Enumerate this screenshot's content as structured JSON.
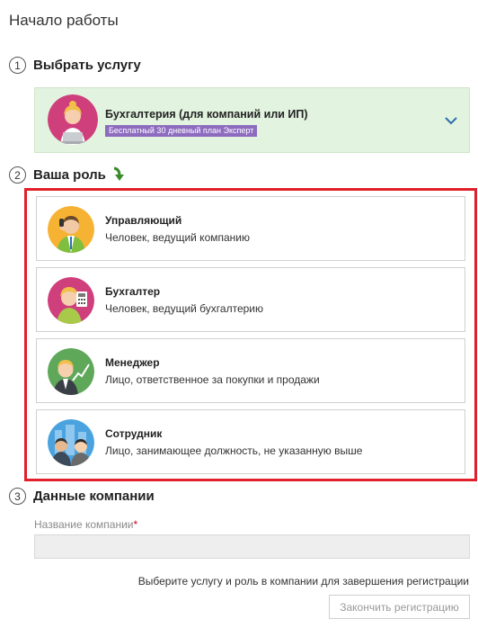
{
  "page": {
    "title": "Начало работы"
  },
  "steps": [
    {
      "number": "1",
      "title": "Выбрать услугу"
    },
    {
      "number": "2",
      "title": "Ваша роль"
    },
    {
      "number": "3",
      "title": "Данные компании"
    }
  ],
  "service": {
    "title": "Бухгалтерия (для компаний или ИП)",
    "badge": "Бесплатный 30 дневный план Эксперт",
    "avatar_icon": "accountant-woman-laptop-icon",
    "expand_icon": "chevron-down-icon",
    "background_color": "#e2f3df"
  },
  "roles": [
    {
      "title": "Управляющий",
      "description": "Человек, ведущий компанию",
      "icon": "manager-phone-icon",
      "color": "#f6b233"
    },
    {
      "title": "Бухгалтер",
      "description": "Человек, ведущий бухгалтерию",
      "icon": "accountant-calculator-icon",
      "color": "#cf3f7c"
    },
    {
      "title": "Менеджер",
      "description": "Лицо, ответственное за покупки и продажи",
      "icon": "manager-chart-icon",
      "color": "#5fa85a"
    },
    {
      "title": "Сотрудник",
      "description": "Лицо, занимающее должность, не указанную выше",
      "icon": "employees-city-icon",
      "color": "#4aa3df"
    }
  ],
  "company": {
    "label": "Название компании",
    "required_mark": "*",
    "value": "",
    "placeholder": ""
  },
  "footer": {
    "hint": "Выберите услугу и роль в компании для завершения регистрации",
    "finish_label": "Закончить регистрацию"
  },
  "colors": {
    "highlight": "#e0202a",
    "badge": "#8d6cc0",
    "arrow": "#3a8a2a"
  }
}
